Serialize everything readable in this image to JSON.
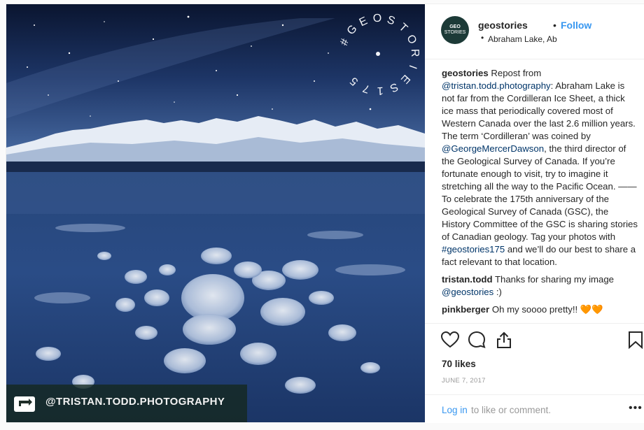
{
  "media": {
    "stamp_text": "#GEOSTORIES175",
    "credit_handle": "@TRISTAN.TODD.PHOTOGRAPHY"
  },
  "header": {
    "avatar_line1": "GEO",
    "avatar_line2": "STORIES",
    "username": "geostories",
    "separator": "•",
    "follow": "Follow",
    "location_bullet": "•",
    "location": "Abraham Lake, Ab"
  },
  "comments": [
    {
      "user": "geostories",
      "parts": [
        {
          "t": " Repost from "
        },
        {
          "t": "@tristan.todd.photography",
          "link": true
        },
        {
          "t": ": Abraham Lake is not far from the Cordilleran Ice Sheet, a thick ice mass that periodically covered most of Western Canada over the last 2.6 million years. The term ‘Cordilleran’ was coined by "
        },
        {
          "t": "@GeorgeMercerDawson",
          "link": true
        },
        {
          "t": ", the third director of the Geological Survey of Canada. If you’re fortunate enough to visit, try to imagine it stretching all the way to the Pacific Ocean. —— To celebrate the 175th anniversary of the Geological Survey of Canada (GSC), the History Committee of the GSC is sharing stories of Canadian geology. Tag your photos with "
        },
        {
          "t": "#geostories175",
          "link": true
        },
        {
          "t": " and we’ll do our best to share a fact relevant to that location."
        }
      ]
    },
    {
      "user": "tristan.todd",
      "parts": [
        {
          "t": " Thanks for sharing my image "
        },
        {
          "t": "@geostories",
          "link": true
        },
        {
          "t": " :)"
        }
      ]
    },
    {
      "user": "pinkberger",
      "parts": [
        {
          "t": " Oh my soooo pretty!! 🧡🧡"
        }
      ]
    }
  ],
  "actions": {
    "likes": "70 likes",
    "date": "JUNE 7, 2017",
    "login_link": "Log in",
    "login_rest": " to like or comment.",
    "more": "•••"
  },
  "icons": {
    "like": "heart-icon",
    "comment": "comment-icon",
    "share": "share-icon",
    "save": "bookmark-icon",
    "repost": "repost-icon"
  },
  "colors": {
    "link": "#003569",
    "follow": "#3897f0",
    "muted": "#999999",
    "avatar": "#1c3a37"
  }
}
